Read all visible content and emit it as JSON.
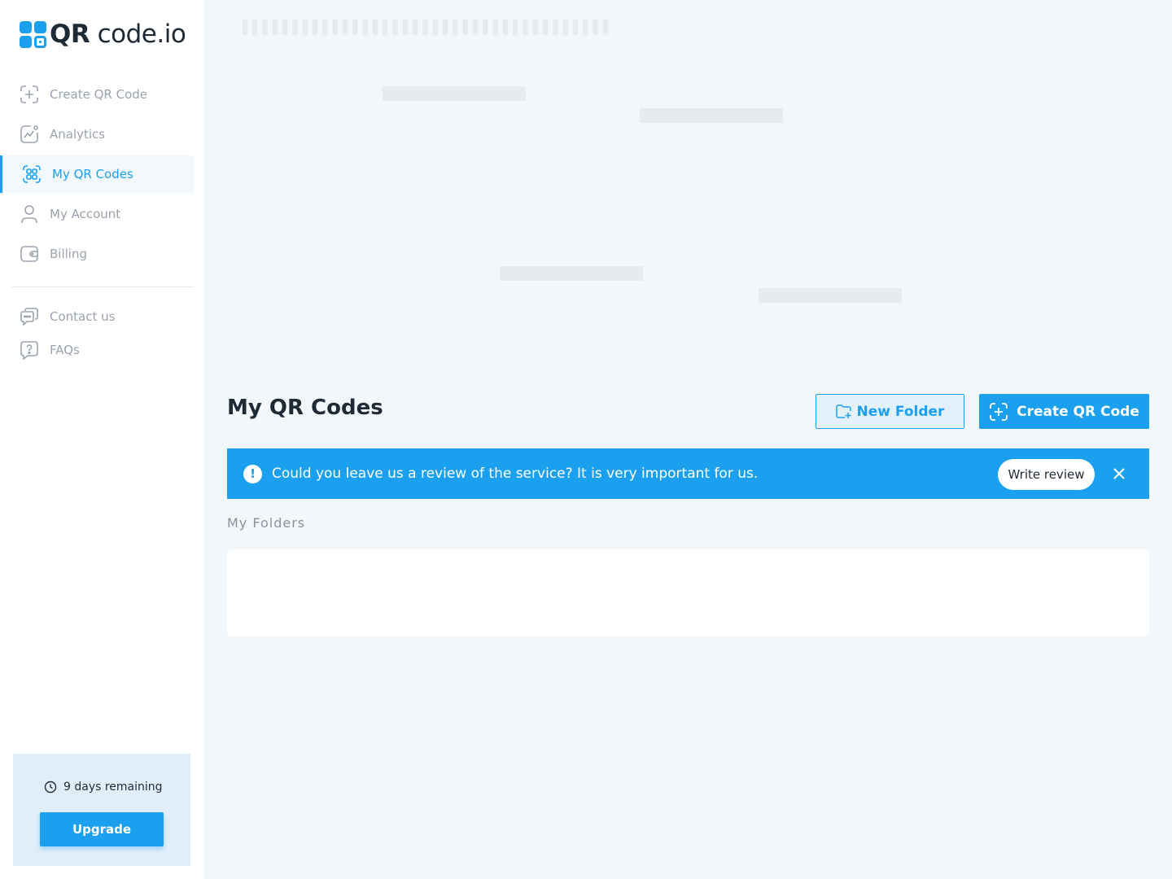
{
  "brand": {
    "logo_bold": "QR",
    "logo_rest": " code.io"
  },
  "sidebar": {
    "items": [
      {
        "label": "Create QR Code",
        "icon": "plus-square-icon"
      },
      {
        "label": "Analytics",
        "icon": "chart-icon"
      },
      {
        "label": "My QR Codes",
        "icon": "qr-grid-icon",
        "active": true
      },
      {
        "label": "My Account",
        "icon": "user-icon"
      },
      {
        "label": "Billing",
        "icon": "wallet-icon"
      }
    ],
    "secondary": [
      {
        "label": "Contact us",
        "icon": "chat-icon"
      },
      {
        "label": "FAQs",
        "icon": "question-icon"
      }
    ],
    "trial": {
      "remaining": "9 days remaining",
      "upgrade_label": "Upgrade"
    }
  },
  "main": {
    "title": "My QR Codes",
    "new_folder_label": "New Folder",
    "create_label": "Create QR Code",
    "banner": {
      "message": "Could you leave us a review of the service? It is very important for us.",
      "review_label": "Write review"
    },
    "folders_label": "My Folders"
  },
  "colors": {
    "accent": "#1aa0ee",
    "background": "#f2f7fb",
    "banner": "#1aa0ee"
  }
}
